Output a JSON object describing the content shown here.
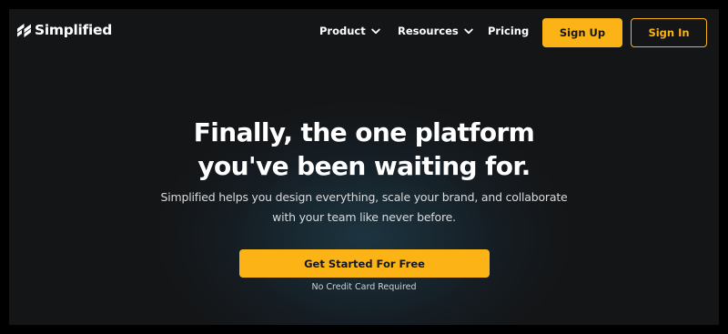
{
  "header": {
    "logo_text": "Simplified",
    "logo_icon": "simplified-logo-icon",
    "nav": {
      "product": "Product",
      "resources": "Resources",
      "pricing": "Pricing"
    },
    "dropdown_icon": "chevron-down-icon",
    "sign_up": "Sign Up",
    "sign_in": "Sign In"
  },
  "hero": {
    "headline_line1": "Finally, the one platform",
    "headline_line2": "you've been waiting for.",
    "subtext_line1": "Simplified helps you design everything, scale your brand, and collaborate",
    "subtext_line2": "with your team like never before.",
    "cta_label": "Get Started For Free",
    "cta_note": "No Credit Card Required"
  },
  "colors": {
    "accent": "#fcb316",
    "background": "#151516",
    "frame_border": "#000000",
    "text": "#ffffff"
  }
}
